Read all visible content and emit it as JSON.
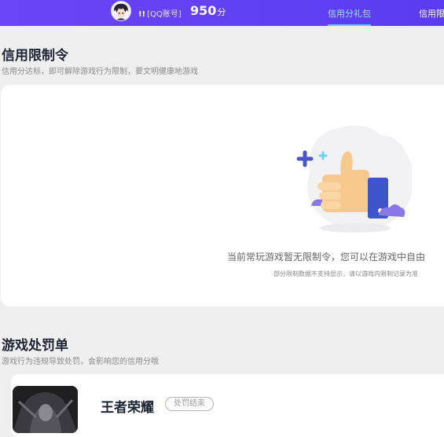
{
  "header": {
    "username_mark": "!!",
    "account_label": "[QQ账号]",
    "credit_score": "950",
    "credit_unit": "分",
    "tabs": [
      {
        "label": "信用分礼包",
        "active": true
      },
      {
        "label": "信用限",
        "active": false
      }
    ]
  },
  "restriction": {
    "title": "信用限制令",
    "subtitle": "信用分达标，即可解除游戏行为限制，要文明健康地游戏",
    "empty_message": "当前常玩游戏暂无限制令，您可以在游戏中自由",
    "empty_note": "部分限制数据不支持显示，请以游戏内限制记录为准",
    "illustration_icon": "thumbs-up-icon"
  },
  "punishment": {
    "title": "游戏处罚单",
    "subtitle": "游戏行为违规导致处罚，会影响您的信用分哦",
    "items": [
      {
        "game": "王者荣耀",
        "status": "处罚结束"
      }
    ]
  },
  "colors": {
    "header_bg": "#5b3cf2",
    "active_tab": "#9ee6ff",
    "page_bg": "#efefef"
  }
}
